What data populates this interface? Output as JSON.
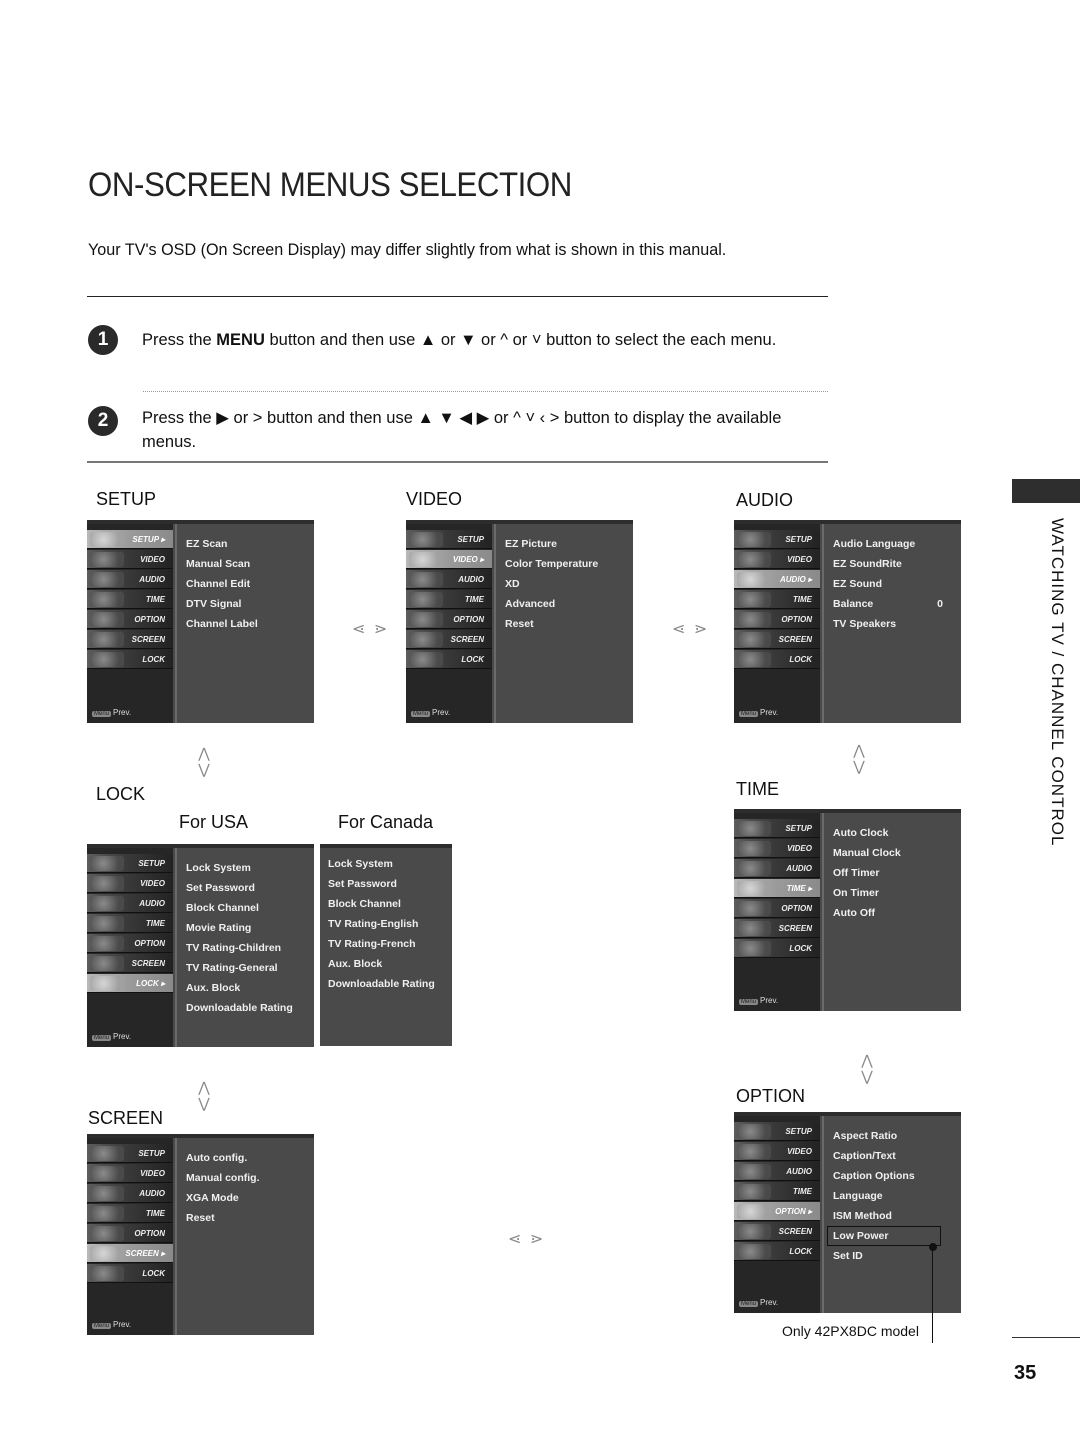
{
  "page": {
    "title": "ON-SCREEN MENUS SELECTION",
    "subtitle": "Your TV's OSD (On Screen Display) may differ slightly from what is shown in this manual.",
    "side_title": "WATCHING TV / CHANNEL CONTROL",
    "page_number": "35"
  },
  "steps": [
    {
      "number": "1",
      "pre": "Press the ",
      "key": "MENU",
      "post": " button and then use  ▲ or ▼  or  ^  or  ˅  button to select the each menu."
    },
    {
      "number": "2",
      "text": "Press the ▶  or  >  button and then use ▲ ▼ ◀ ▶ or  ^ ˅ ‹  > button to display the available menus."
    }
  ],
  "osd_sidebar": [
    "SETUP",
    "VIDEO",
    "AUDIO",
    "TIME",
    "OPTION",
    "SCREEN",
    "LOCK"
  ],
  "osd_prev": {
    "key": "Menu",
    "label": "Prev."
  },
  "nav": {
    "left_right": "⋖ ⋗",
    "up": "⋀",
    "down": "⋁"
  },
  "menus": {
    "setup": {
      "label": "SETUP",
      "active": "SETUP",
      "items": [
        "EZ Scan",
        "Manual Scan",
        "Channel Edit",
        "DTV Signal",
        "Channel Label"
      ]
    },
    "video": {
      "label": "VIDEO",
      "active": "VIDEO",
      "items": [
        "EZ Picture",
        "Color Temperature",
        "XD",
        "Advanced",
        "Reset"
      ]
    },
    "audio": {
      "label": "AUDIO",
      "active": "AUDIO",
      "items": [
        "Audio Language",
        "EZ SoundRite",
        "EZ Sound",
        "Balance",
        "TV Speakers"
      ],
      "balance_value": "0"
    },
    "lock": {
      "label": "LOCK",
      "active": "LOCK",
      "usa_label": "For USA",
      "canada_label": "For Canada",
      "usa_items": [
        "Lock System",
        "Set Password",
        "Block Channel",
        "Movie Rating",
        "TV Rating-Children",
        "TV Rating-General",
        "Aux. Block",
        "Downloadable Rating"
      ],
      "canada_items": [
        "Lock System",
        "Set Password",
        "Block Channel",
        "TV Rating-English",
        "TV Rating-French",
        "Aux. Block",
        "Downloadable Rating"
      ]
    },
    "time": {
      "label": "TIME",
      "active": "TIME",
      "items": [
        "Auto Clock",
        "Manual Clock",
        "Off Timer",
        "On Timer",
        "Auto Off"
      ]
    },
    "screen": {
      "label": "SCREEN",
      "active": "SCREEN",
      "items": [
        "Auto config.",
        "Manual config.",
        "XGA Mode",
        "Reset"
      ]
    },
    "option": {
      "label": "OPTION",
      "active": "OPTION",
      "items": [
        "Aspect Ratio",
        "Caption/Text",
        "Caption Options",
        "Language",
        "ISM Method",
        "Low Power",
        "Set ID"
      ],
      "note": "Only 42PX8DC model"
    }
  }
}
